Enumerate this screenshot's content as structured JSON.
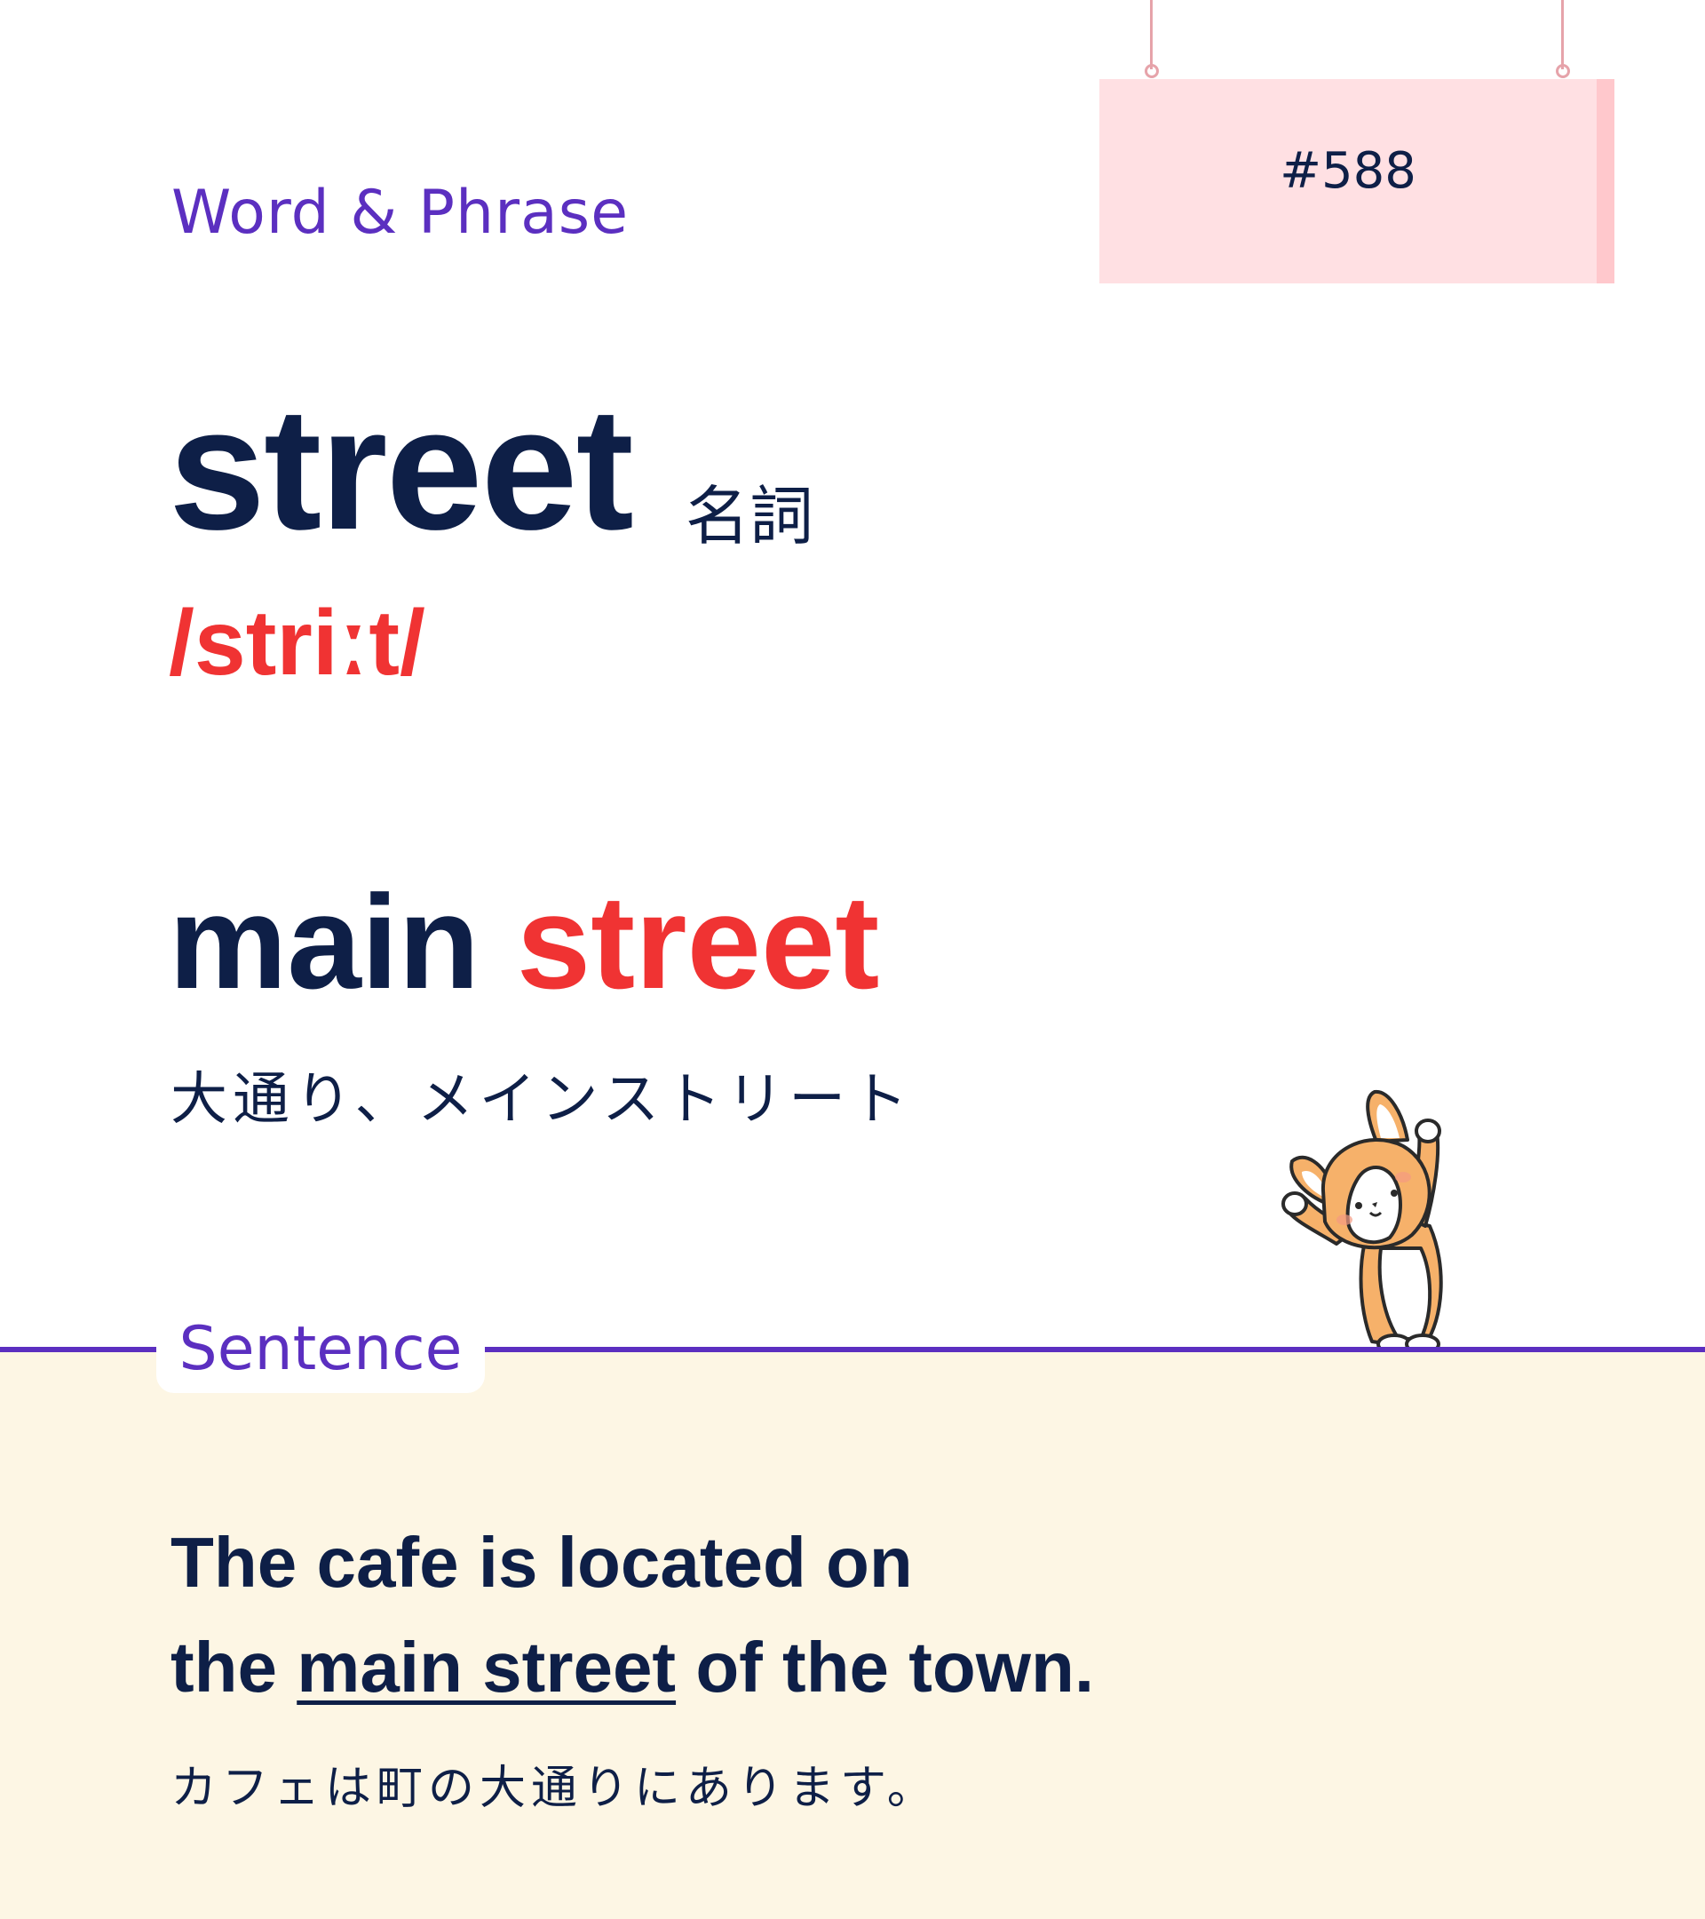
{
  "header": {
    "category": "Word & Phrase",
    "card_number": "#588"
  },
  "word": {
    "headword": "street",
    "part_of_speech": "名詞",
    "pronunciation": "/striːt/"
  },
  "phrase": {
    "word1": "main",
    "word2": "street",
    "meaning": "大通り、メインストリート"
  },
  "sentence_section": {
    "label": "Sentence",
    "line1": "The cafe is located on",
    "line2_before": "the",
    "line2_highlight": "main street",
    "line2_after": "of the town.",
    "translation": "カフェは町の大通りにあります。"
  },
  "colors": {
    "navy": "#0e1f47",
    "accent_red": "#f03333",
    "purple": "#5b2fc0",
    "sign_pink": "#ffe0e3",
    "panel_cream": "#fdf6e4"
  },
  "mascot": "corgi-dog-waving"
}
